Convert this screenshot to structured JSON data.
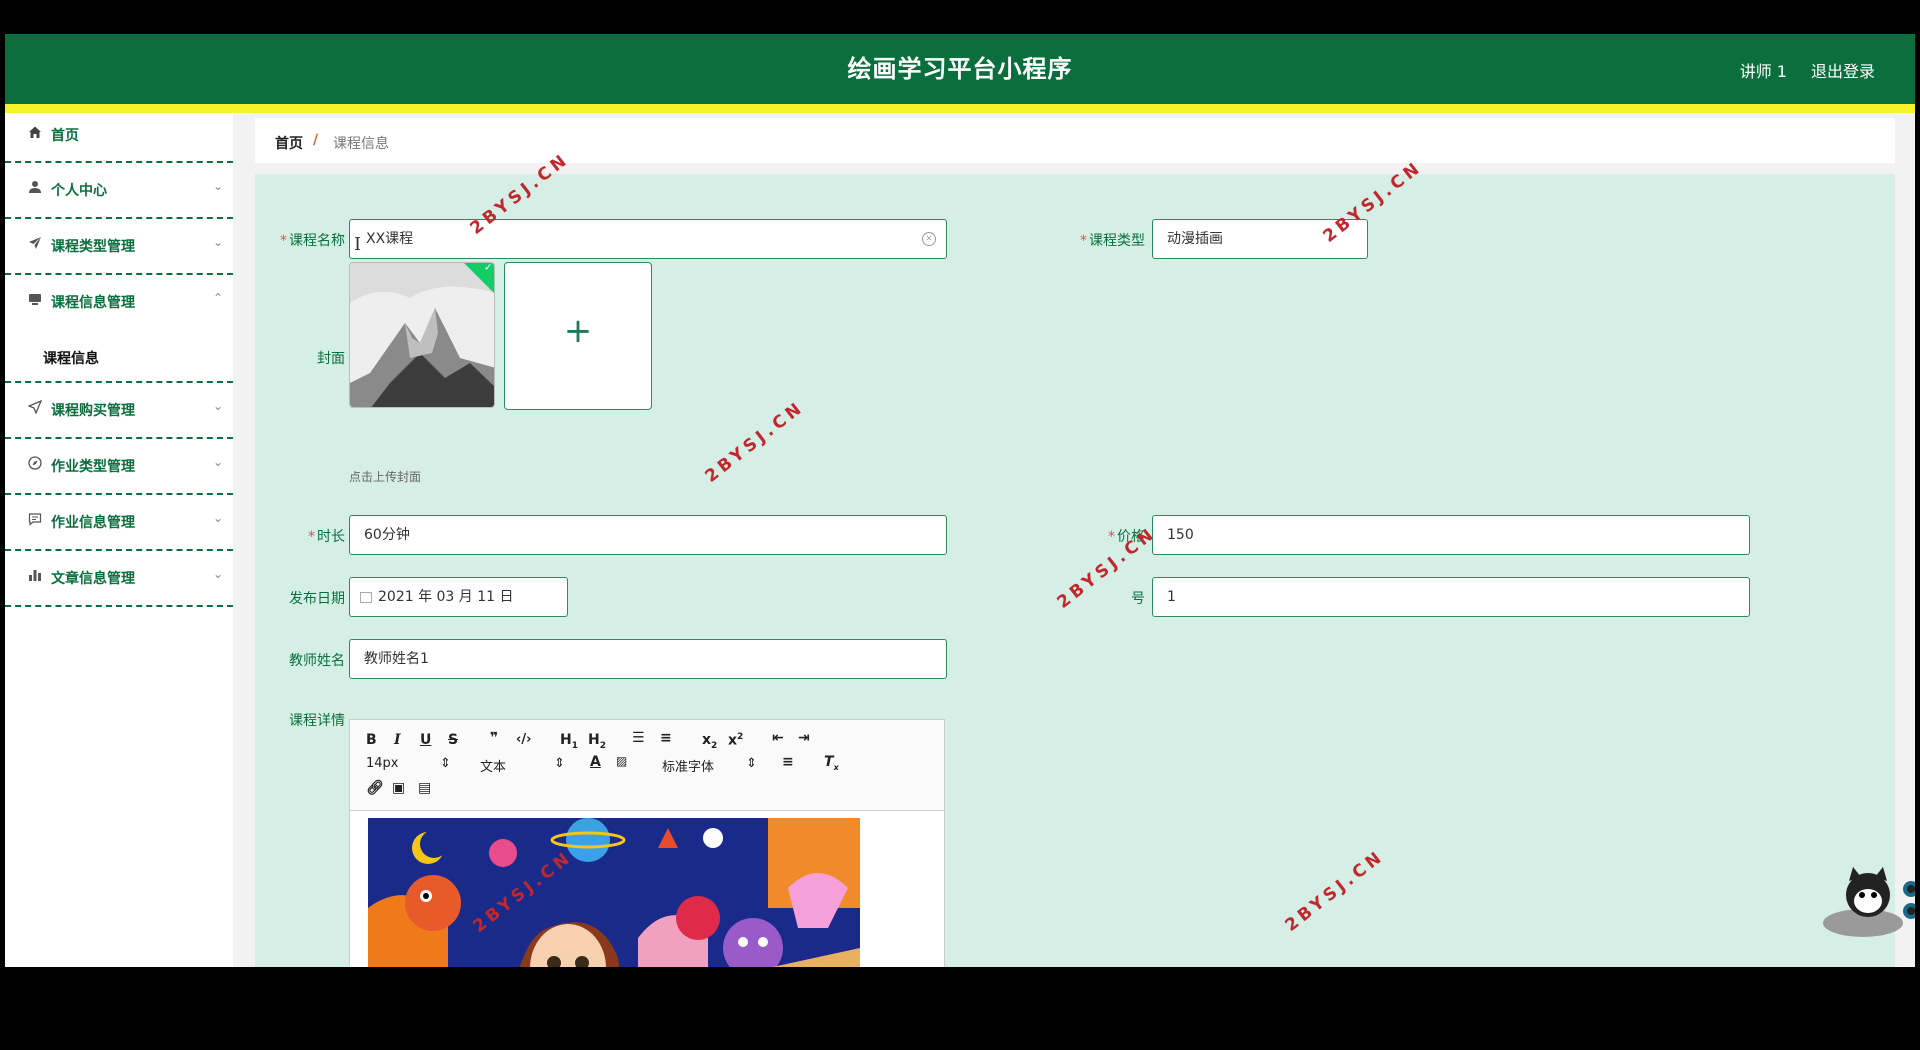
{
  "app": {
    "title": "绘画学习平台小程序",
    "user": "讲师 1",
    "logout": "退出登录"
  },
  "sidebar": {
    "items": [
      {
        "label": "首页",
        "icon": "home-icon"
      },
      {
        "label": "个人中心",
        "icon": "user-icon"
      },
      {
        "label": "课程类型管理",
        "icon": "paper-plane-icon"
      },
      {
        "label": "课程信息管理",
        "icon": "monitor-icon",
        "expanded": true
      },
      {
        "label": "课程购买管理",
        "icon": "send-icon"
      },
      {
        "label": "作业类型管理",
        "icon": "compass-icon"
      },
      {
        "label": "作业信息管理",
        "icon": "chat-icon"
      },
      {
        "label": "文章信息管理",
        "icon": "bar-chart-icon"
      }
    ],
    "submenu": {
      "label": "课程信息"
    }
  },
  "breadcrumb": {
    "home": "首页",
    "separator": "/",
    "current": "课程信息"
  },
  "form": {
    "course_name": {
      "label": "课程名称",
      "value": "XX课程"
    },
    "course_type": {
      "label": "课程类型",
      "value": "动漫插画"
    },
    "cover": {
      "label": "封面",
      "hint": "点击上传封面"
    },
    "duration": {
      "label": "时长",
      "value": "60分钟"
    },
    "price": {
      "label": "价格",
      "value": "150"
    },
    "publish_date": {
      "label": "发布日期",
      "value": "2021 年 03 月 11 日"
    },
    "order": {
      "label": "号",
      "value": "1"
    },
    "teacher_name": {
      "label": "教师姓名",
      "value": "教师姓名1"
    },
    "details": {
      "label": "课程详情"
    },
    "required_mark": "*"
  },
  "editor": {
    "font_size": "14px",
    "text_style": "文本",
    "font_family": "标准字体",
    "buttons": [
      "B",
      "I",
      "U",
      "S",
      "99",
      "</>",
      "H1",
      "H2",
      "ordered-list",
      "bullet-list",
      "x2-sub",
      "x2-sup",
      "outdent",
      "indent"
    ]
  },
  "watermark": "2BYSJ.CN",
  "colors": {
    "header": "#0a6f3d",
    "accent_strip": "#f6f22a",
    "content_bg": "#d6efe6",
    "required": "#e24b4b",
    "watermark": "#c1282e"
  }
}
